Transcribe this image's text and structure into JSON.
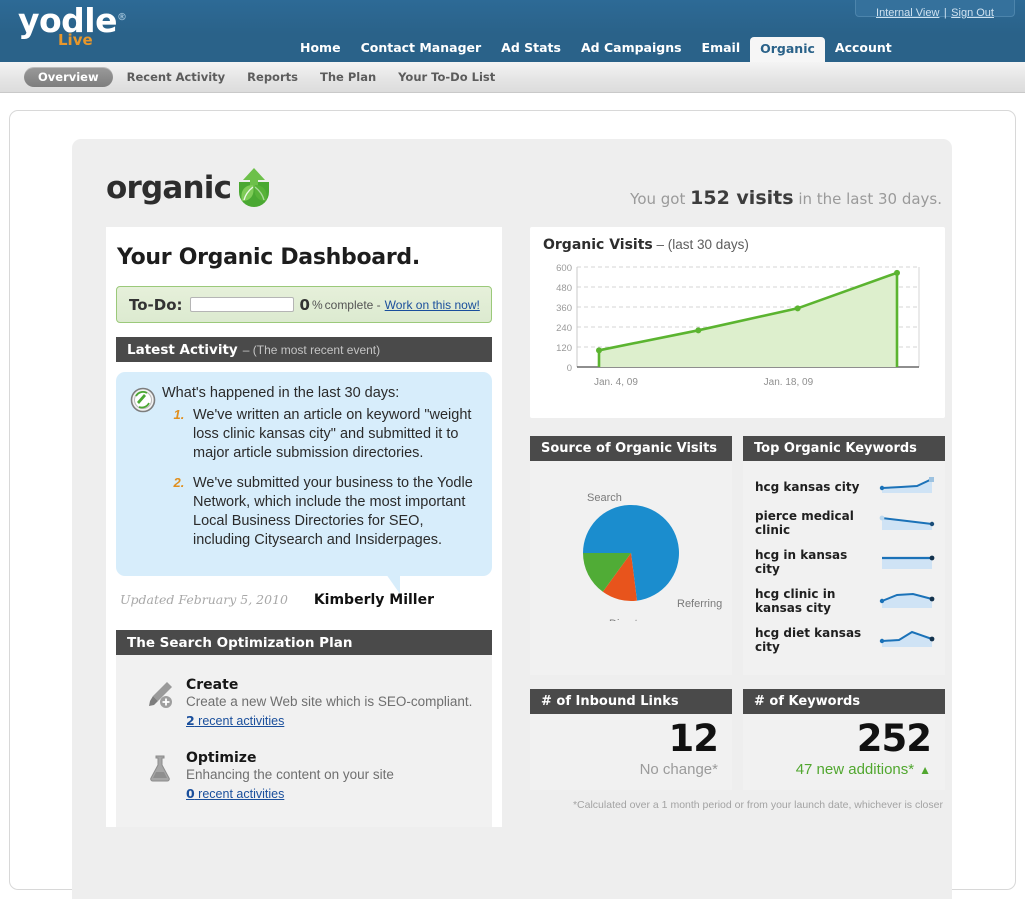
{
  "topbar": {
    "logo_text": "yodle",
    "logo_registered": "®",
    "logo_sub": "Live",
    "internal_view": "Internal View",
    "separator": "|",
    "sign_out": "Sign Out",
    "nav": [
      {
        "label": "Home",
        "active": false
      },
      {
        "label": "Contact Manager",
        "active": false
      },
      {
        "label": "Ad Stats",
        "active": false
      },
      {
        "label": "Ad Campaigns",
        "active": false
      },
      {
        "label": "Email",
        "active": false
      },
      {
        "label": "Organic",
        "active": true
      },
      {
        "label": "Account",
        "active": false
      }
    ]
  },
  "subnav": [
    {
      "label": "Overview",
      "active": true
    },
    {
      "label": "Recent Activity",
      "active": false
    },
    {
      "label": "Reports",
      "active": false
    },
    {
      "label": "The Plan",
      "active": false
    },
    {
      "label": "Your To-Do List",
      "active": false
    }
  ],
  "brand": {
    "word": "organic",
    "icon": "leaf-sprout-icon"
  },
  "visits_summary": {
    "prefix": "You got",
    "value": "152 visits",
    "suffix": "in the last 30 days."
  },
  "dashboard": {
    "title": "Your Organic Dashboard.",
    "todo": {
      "label": "To-Do:",
      "percent": "0",
      "percent_symbol": "%",
      "complete_text": " complete - ",
      "link": "Work on this now!",
      "progress_value": 0
    },
    "latest_activity": {
      "heading": "Latest Activity",
      "subheading": "– (The most recent event)",
      "icon": "activity-refresh-icon",
      "intro": "What's happened in the last 30 days:",
      "items": [
        "We've written an article on keyword \"weight loss clinic kansas city\" and submitted it to major article submission directories.",
        "We've submitted your business to the Yodle Network, which include the most important Local Business Directories for SEO, including Citysearch and Insiderpages."
      ],
      "updated": "Updated February 5, 2010",
      "signature": "Kimberly Miller"
    },
    "plan": {
      "heading": "The Search Optimization Plan",
      "items": [
        {
          "icon": "paintbrush-plus-icon",
          "title": "Create",
          "desc": "Create a new Web site which is SEO-compliant.",
          "link_count": "2",
          "link_text": " recent activities"
        },
        {
          "icon": "flask-icon",
          "title": "Optimize",
          "desc": "Enhancing the content on your site",
          "link_count": "0",
          "link_text": " recent activities"
        }
      ]
    }
  },
  "panels": {
    "source_title": "Source of Organic Visits",
    "keywords_title": "Top Organic Keywords",
    "keywords": [
      {
        "name": "hcg kansas city",
        "spark": "rise-end"
      },
      {
        "name": "pierce medical clinic",
        "spark": "slow-decline"
      },
      {
        "name": "hcg in kansas city",
        "spark": "flat"
      },
      {
        "name": "hcg clinic in kansas city",
        "spark": "hump"
      },
      {
        "name": "hcg diet kansas city",
        "spark": "peak"
      }
    ],
    "inbound_links": {
      "title": "# of Inbound Links",
      "value": "12",
      "change": "No change*",
      "change_positive": false
    },
    "keyword_count": {
      "title": "# of Keywords",
      "value": "252",
      "change": "47 new additions*",
      "change_positive": true,
      "arrow": "▲"
    },
    "footnote": "*Calculated over a 1 month period or from your launch date, whichever is closer"
  },
  "colors": {
    "nav_blue": "#2a6289",
    "green": "#5bb430",
    "pie_search": "#1b8dce",
    "pie_referring": "#e8541c",
    "pie_direct": "#50ac36",
    "dark_header": "#4a4a4a",
    "link_blue": "#1a4f9c",
    "orange": "#e8972b"
  },
  "chart_data": [
    {
      "type": "area",
      "title": "Organic Visits",
      "subtitle": "– (last 30 days)",
      "x": [
        "Jan. 4, 09",
        "",
        "Jan. 18, 09",
        ""
      ],
      "xtick_labels": [
        "Jan. 4, 09",
        "Jan. 18, 09"
      ],
      "values": [
        100,
        220,
        352,
        565
      ],
      "ytick_labels": [
        "0",
        "120",
        "240",
        "360",
        "480",
        "600"
      ],
      "ylim": [
        0,
        600
      ],
      "ylabel": "",
      "xlabel": "",
      "grid": true,
      "legend": "none",
      "line_color": "#5bb430",
      "fill_color": "#ddefcd"
    },
    {
      "type": "pie",
      "title": "Source of Organic Visits",
      "categories": [
        "Search",
        "Referring",
        "Direct"
      ],
      "values": [
        73,
        12,
        15
      ],
      "colors": [
        "#1b8dce",
        "#e8541c",
        "#50ac36"
      ],
      "legend": "labels-around-pie"
    }
  ]
}
